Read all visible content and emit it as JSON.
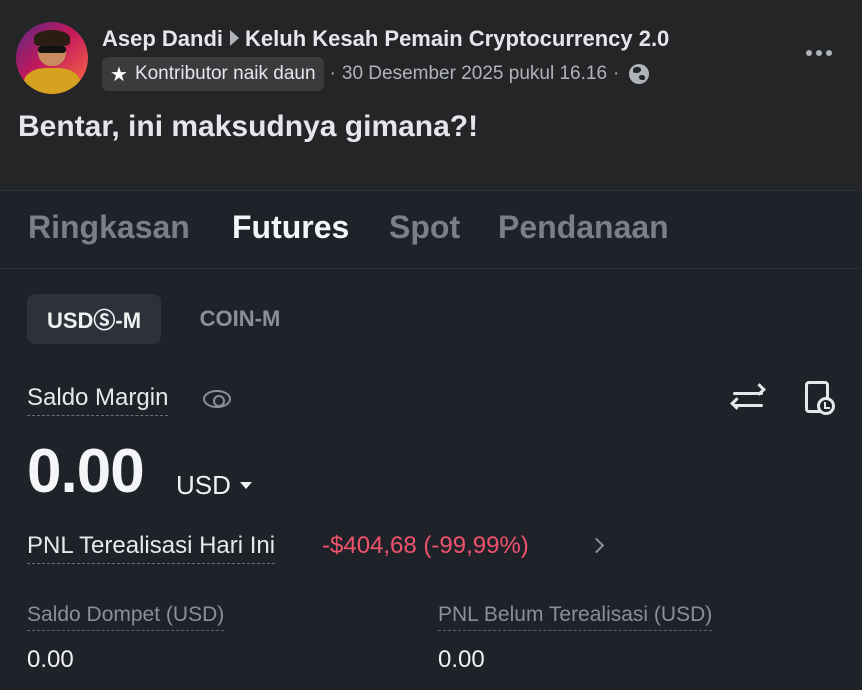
{
  "post": {
    "author": "Asep Dandi",
    "group": "Keluh Kesah Pemain Cryptocurrency 2.0",
    "badge_label": "Kontributor naik daun",
    "timestamp": "30 Desember 2025 pukul 16.16",
    "separator": "·",
    "text": "Bentar, ini maksudnya gimana?!",
    "icons": [
      "star-icon",
      "globe-icon",
      "more-options-icon"
    ]
  },
  "app": {
    "tabs": [
      {
        "label": "Ringkasan",
        "active": false
      },
      {
        "label": "Futures",
        "active": true
      },
      {
        "label": "Spot",
        "active": false
      },
      {
        "label": "Pendanaan",
        "active": false
      }
    ],
    "segments": [
      {
        "label": "USDⓈ-M",
        "active": true
      },
      {
        "label": "COIN-M",
        "active": false
      }
    ],
    "margin_label": "Saldo Margin",
    "balance": "0.00",
    "currency": "USD",
    "pnl_label": "PNL Terealisasi Hari Ini",
    "pnl_value": "-$404,68 (-99,99%)",
    "wallet_label": "Saldo Dompet (USD)",
    "wallet_value": "0.00",
    "unrealized_label": "PNL Belum Terealisasi (USD)",
    "unrealized_value": "0.00",
    "icons": [
      "eye-icon",
      "transfer-icon",
      "history-icon",
      "caret-down-icon",
      "chevron-right-icon"
    ]
  },
  "colors": {
    "post_bg": "#242526",
    "app_bg": "#1f2229",
    "negative": "#f0526d",
    "muted": "#8a8f99"
  }
}
